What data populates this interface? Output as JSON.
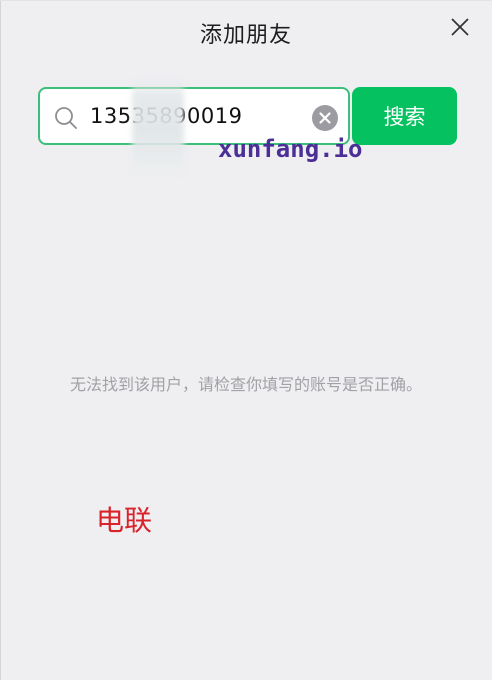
{
  "dialog": {
    "title": "添加朋友",
    "close_icon": "close-icon"
  },
  "search": {
    "value": "13535890019",
    "icon": "search-icon",
    "clear_icon": "clear-circle-icon",
    "button_label": "搜索",
    "accent_color": "#06c160"
  },
  "watermark": "xunfang.io",
  "result": {
    "message": "无法找到该用户，请检查你填写的账号是否正确。"
  },
  "annotation": {
    "text": "电联",
    "color": "#d9232a"
  }
}
